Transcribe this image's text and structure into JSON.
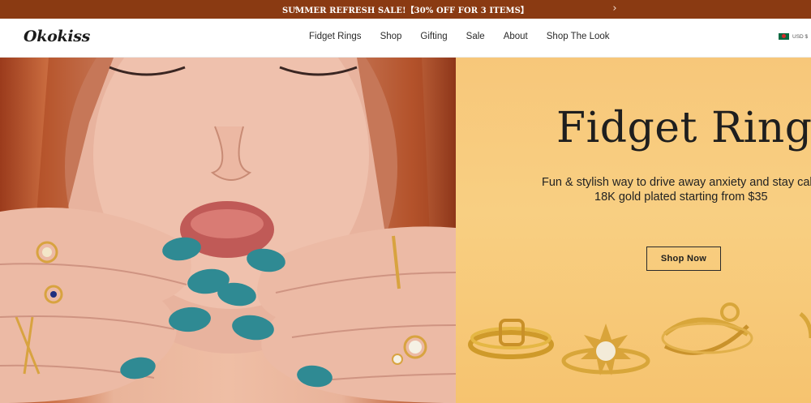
{
  "announcement": {
    "text": "SUMMER REFRESH SALE!【30% OFF FOR 3 ITEMS】",
    "prev_icon": "chevron-left-icon",
    "next_icon": "chevron-right-icon",
    "background": "#8a3a12"
  },
  "header": {
    "logo": "Okokiss",
    "nav": [
      {
        "label": "Fidget Rings"
      },
      {
        "label": "Shop"
      },
      {
        "label": "Gifting"
      },
      {
        "label": "Sale"
      },
      {
        "label": "About"
      },
      {
        "label": "Shop The Look"
      }
    ],
    "currency": {
      "flag_icon": "bangladesh-flag-icon",
      "code": "USD $"
    }
  },
  "hero": {
    "title": "Fidget Rings",
    "subtitle_line1": "Fun & stylish way to drive away anxiety and stay calm",
    "subtitle_line2": "18K gold plated starting from $35",
    "cta_label": "Shop Now",
    "panel_color": "#f8cf82"
  }
}
